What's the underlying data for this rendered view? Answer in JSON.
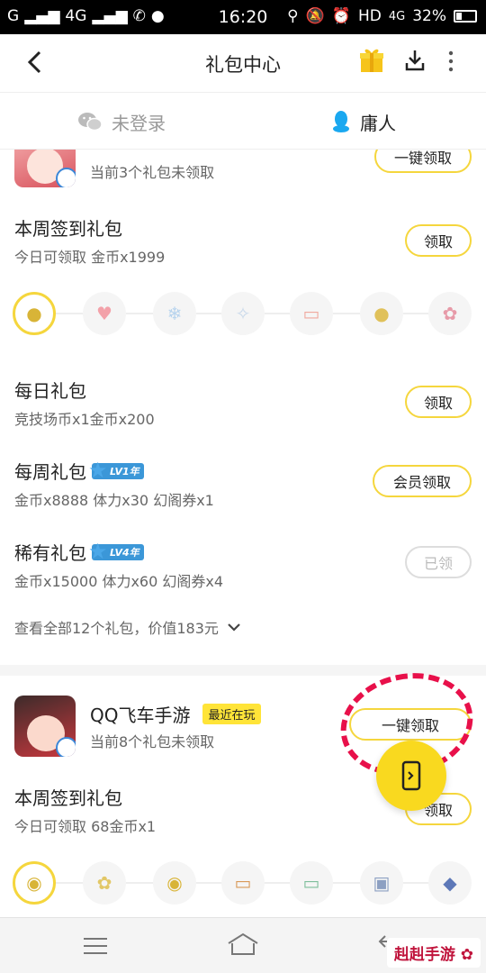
{
  "status_bar": {
    "left": "G",
    "network": "4G",
    "time": "16:20",
    "hd": "HD",
    "network2": "4G",
    "battery": "32%",
    "battery_level": 0.32
  },
  "header": {
    "title": "礼包中心"
  },
  "tabs": [
    {
      "label": "未登录",
      "icon": "wechat-icon"
    },
    {
      "label": "庸人",
      "icon": "qq-icon"
    }
  ],
  "game1": {
    "subtitle": "当前3个礼包未领取",
    "claim_all": "一键领取",
    "weekly_signin": {
      "title": "本周签到礼包",
      "desc": "今日可领取 金币x1999",
      "button": "领取"
    },
    "gifts": [
      {
        "title": "每日礼包",
        "desc": "竞技场币x1金币x200",
        "button": "领取",
        "badge": ""
      },
      {
        "title": "每周礼包",
        "desc": "金币x8888 体力x30 幻阁券x1",
        "button": "会员领取",
        "badge": "LV1年"
      },
      {
        "title": "稀有礼包",
        "desc": "金币x15000 体力x60 幻阁券x4",
        "button": "已领",
        "badge": "LV4年"
      }
    ],
    "view_all": "查看全部12个礼包，价值183元"
  },
  "game2": {
    "name": "QQ飞车手游",
    "tag": "最近在玩",
    "subtitle": "当前8个礼包未领取",
    "claim_all": "一键领取",
    "weekly_signin": {
      "title": "本周签到礼包",
      "desc": "今日可领取 68金币x1",
      "button": "领取"
    }
  },
  "watermark": "赳赳手游"
}
